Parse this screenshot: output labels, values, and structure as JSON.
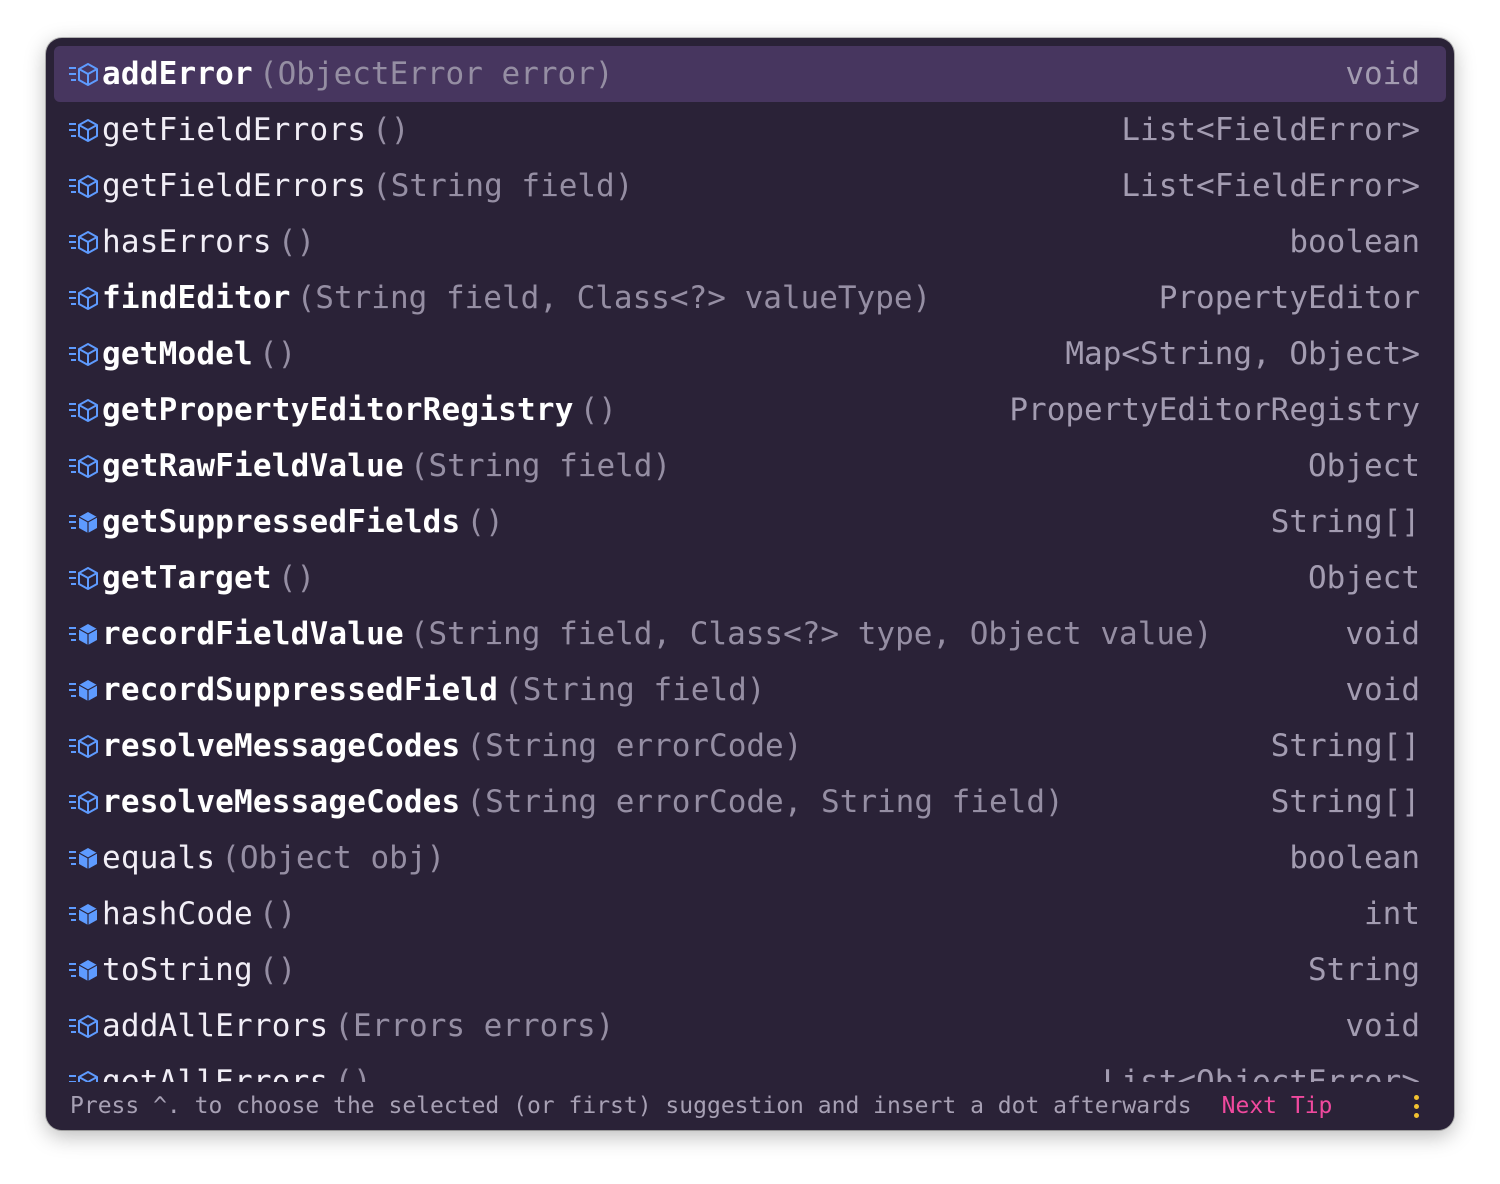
{
  "popup": {
    "background": "#2a2237",
    "selected_background": "#47365f",
    "items": [
      {
        "name": "addError",
        "params": "(ObjectError error)",
        "type": "void",
        "bold": true,
        "selected": true,
        "icon": "method-icon"
      },
      {
        "name": "getFieldErrors",
        "params": "()",
        "type": "List<FieldError>",
        "bold": false,
        "icon": "method-icon"
      },
      {
        "name": "getFieldErrors",
        "params": "(String field)",
        "type": "List<FieldError>",
        "bold": false,
        "icon": "method-icon"
      },
      {
        "name": "hasErrors",
        "params": "()",
        "type": "boolean",
        "bold": false,
        "icon": "method-icon"
      },
      {
        "name": "findEditor",
        "params": "(String field, Class<?> valueType)",
        "type": "PropertyEditor",
        "bold": true,
        "icon": "method-icon"
      },
      {
        "name": "getModel",
        "params": "()",
        "type": "Map<String, Object>",
        "bold": true,
        "icon": "method-icon"
      },
      {
        "name": "getPropertyEditorRegistry",
        "params": "()",
        "type": "PropertyEditorRegistry",
        "bold": true,
        "icon": "method-icon"
      },
      {
        "name": "getRawFieldValue",
        "params": "(String field)",
        "type": "Object",
        "bold": true,
        "icon": "method-icon"
      },
      {
        "name": "getSuppressedFields",
        "params": "()",
        "type": "String[]",
        "bold": true,
        "icon": "method-filled-icon"
      },
      {
        "name": "getTarget",
        "params": "()",
        "type": "Object",
        "bold": true,
        "icon": "method-icon"
      },
      {
        "name": "recordFieldValue",
        "params": "(String field, Class<?> type, Object value)",
        "type": "void",
        "bold": true,
        "icon": "method-filled-icon"
      },
      {
        "name": "recordSuppressedField",
        "params": "(String field)",
        "type": "void",
        "bold": true,
        "icon": "method-filled-icon"
      },
      {
        "name": "resolveMessageCodes",
        "params": "(String errorCode)",
        "type": "String[]",
        "bold": true,
        "icon": "method-icon"
      },
      {
        "name": "resolveMessageCodes",
        "params": "(String errorCode, String field)",
        "type": "String[]",
        "bold": true,
        "icon": "method-icon"
      },
      {
        "name": "equals",
        "params": "(Object obj)",
        "type": "boolean",
        "bold": false,
        "icon": "method-filled-icon"
      },
      {
        "name": "hashCode",
        "params": "()",
        "type": "int",
        "bold": false,
        "icon": "method-filled-icon"
      },
      {
        "name": "toString",
        "params": "()",
        "type": "String",
        "bold": false,
        "icon": "method-filled-icon"
      },
      {
        "name": "addAllErrors",
        "params": "(Errors errors)",
        "type": "void",
        "bold": false,
        "icon": "method-icon"
      },
      {
        "name": "getAllErrors",
        "params": "()",
        "type": "List<ObjectError>",
        "bold": false,
        "icon": "method-icon"
      }
    ],
    "footer": {
      "hint": "Press ^. to choose the selected (or first) suggestion and insert a dot afterwards",
      "next_tip": "Next Tip",
      "next_tip_color": "#f0499e",
      "menu_icon": "vertical-dots-icon",
      "menu_color": "#f2c230"
    }
  }
}
